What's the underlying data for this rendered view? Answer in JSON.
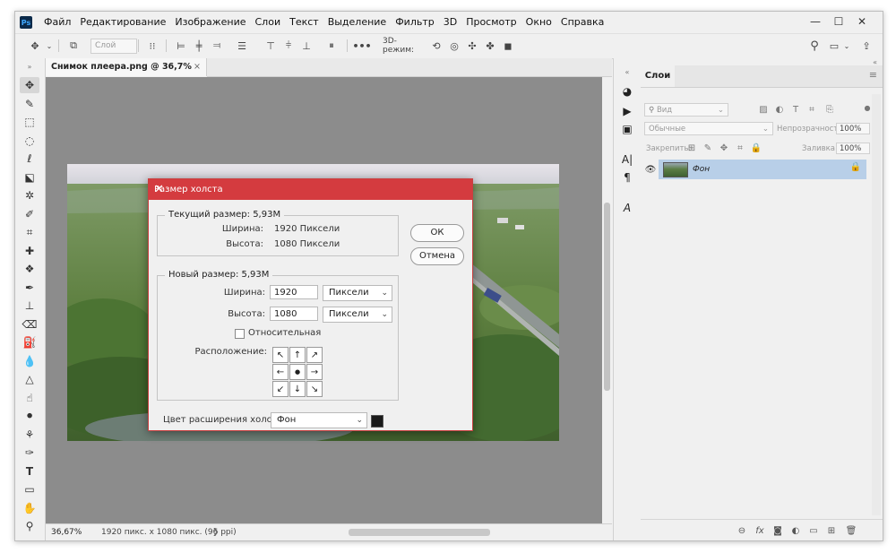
{
  "app": {
    "logo": "Ps"
  },
  "menu": [
    "Файл",
    "Редактирование",
    "Изображение",
    "Слои",
    "Текст",
    "Выделение",
    "Фильтр",
    "3D",
    "Просмотр",
    "Окно",
    "Справка"
  ],
  "window_controls": {
    "minimize": "—",
    "maximize": "☐",
    "close": "✕"
  },
  "options_bar": {
    "layer_select": "Слой",
    "mode_3d": "3D-режим:"
  },
  "document": {
    "tab_title": "Снимок плеера.png @ 36,7% (RGB/8)",
    "tab_close": "×"
  },
  "status": {
    "zoom": "36,67%",
    "info": "1920 пикс. x 1080 пикс. (96 ppi)",
    "arrow": "❯"
  },
  "dialog": {
    "title": "Размер холста",
    "close": "✕",
    "current": {
      "title": "Текущий размер: 5,93M",
      "width_label": "Ширина:",
      "width_value": "1920 Пиксели",
      "height_label": "Высота:",
      "height_value": "1080 Пиксели"
    },
    "new": {
      "title": "Новый размер: 5,93M",
      "width_label": "Ширина:",
      "width_value": "1920",
      "width_unit": "Пиксели",
      "height_label": "Высота:",
      "height_value": "1080",
      "height_unit": "Пиксели",
      "relative_label": "Относительная",
      "relative_checked": false,
      "anchor_label": "Расположение:"
    },
    "anchor_arrows": [
      "↖",
      "↑",
      "↗",
      "←",
      "●",
      "→",
      "↙",
      "↓",
      "↘"
    ],
    "extension_color_label": "Цвет расширения холста:",
    "extension_color_value": "Фон",
    "extension_swatch": "#1a1a1a",
    "ok": "ОК",
    "cancel": "Отмена"
  },
  "layers_panel": {
    "tab": "Слои",
    "filter_placeholder": "Вид",
    "blend_mode": "Обычные",
    "opacity_label": "Непрозрачность:",
    "opacity_value": "100%",
    "lock_label": "Закрепить:",
    "fill_label": "Заливка:",
    "fill_value": "100%",
    "layer_name": "Фон"
  },
  "colors": {
    "accent_red": "#d43b3f",
    "layer_selected": "#b8cfe8",
    "canvas_bg": "#8c8c8c"
  }
}
